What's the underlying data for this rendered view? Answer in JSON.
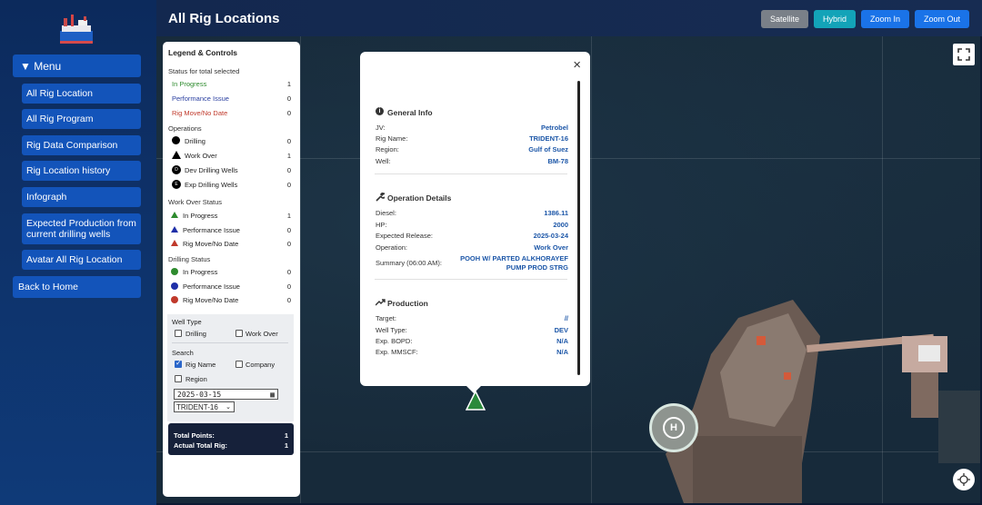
{
  "header": {
    "title": "All Rig Locations",
    "buttons": {
      "satellite": "Satellite",
      "hybrid": "Hybrid",
      "zoom_in": "Zoom In",
      "zoom_out": "Zoom Out"
    }
  },
  "sidebar": {
    "menu_label": "▼ Menu",
    "items": [
      {
        "label": "All Rig Location"
      },
      {
        "label": "All Rig Program"
      },
      {
        "label": "Rig Data Comparison"
      },
      {
        "label": "Rig Location history"
      },
      {
        "label": "Infograph"
      },
      {
        "label": "Expected Production from current drilling wells"
      },
      {
        "label": "Avatar All Rig Location"
      }
    ],
    "back_home": "Back to Home"
  },
  "legend": {
    "title": "Legend & Controls",
    "status_title": "Status for total selected",
    "status": [
      {
        "label": "In Progress",
        "count": "1",
        "color": "#2e8b2e"
      },
      {
        "label": "Performance Issue",
        "count": "0",
        "color": "#2a3fa0"
      },
      {
        "label": "Rig Move/No Date",
        "count": "0",
        "color": "#c0392b"
      }
    ],
    "operations_title": "Operations",
    "operations": [
      {
        "label": "Drilling",
        "count": "0"
      },
      {
        "label": "Work Over",
        "count": "1"
      },
      {
        "label": "Dev Drilling Wells",
        "count": "0"
      },
      {
        "label": "Exp Drilling Wells",
        "count": "0"
      }
    ],
    "workover_title": "Work Over Status",
    "workover": [
      {
        "label": "In Progress",
        "count": "1"
      },
      {
        "label": "Performance Issue",
        "count": "0"
      },
      {
        "label": "Rig Move/No Date",
        "count": "0"
      }
    ],
    "drilling_title": "Drilling Status",
    "drilling": [
      {
        "label": "In Progress",
        "count": "0"
      },
      {
        "label": "Performance Issue",
        "count": "0"
      },
      {
        "label": "Rig Move/No Date",
        "count": "0"
      }
    ],
    "well_type_title": "Well Type",
    "well_type": {
      "drilling": "Drilling",
      "work_over": "Work Over"
    },
    "search_title": "Search",
    "search": {
      "rig_name": "Rig Name",
      "company": "Company",
      "region": "Region"
    },
    "date_value": "2025-03-15",
    "rig_select": "TRIDENT-16",
    "totals": {
      "total_points_label": "Total Points:",
      "total_points": "1",
      "actual_total_label": "Actual Total Rig:",
      "actual_total": "1"
    }
  },
  "popup": {
    "general_title": "General Info",
    "general": [
      {
        "label": "JV:",
        "value": "Petrobel"
      },
      {
        "label": "Rig Name:",
        "value": "TRIDENT-16"
      },
      {
        "label": "Region:",
        "value": "Gulf of Suez"
      },
      {
        "label": "Well:",
        "value": "BM-78"
      }
    ],
    "operation_title": "Operation Details",
    "operation": [
      {
        "label": "Diesel:",
        "value": "1386.11"
      },
      {
        "label": "HP:",
        "value": "2000"
      },
      {
        "label": "Expected Release:",
        "value": "2025-03-24"
      },
      {
        "label": "Operation:",
        "value": "Work Over"
      }
    ],
    "summary_label": "Summary (06:00 AM):",
    "summary_line1": "POOH W/ PARTED ALKHORAYEF",
    "summary_line2": "PUMP PROD STRG",
    "production_title": "Production",
    "production": [
      {
        "label": "Target:",
        "value": "//"
      },
      {
        "label": "Well Type:",
        "value": "DEV"
      },
      {
        "label": "Exp. BOPD:",
        "value": "N/A"
      },
      {
        "label": "Exp. MMSCF:",
        "value": "N/A"
      }
    ],
    "close_glyph": "×"
  },
  "map": {
    "helipad_letter": "H"
  }
}
